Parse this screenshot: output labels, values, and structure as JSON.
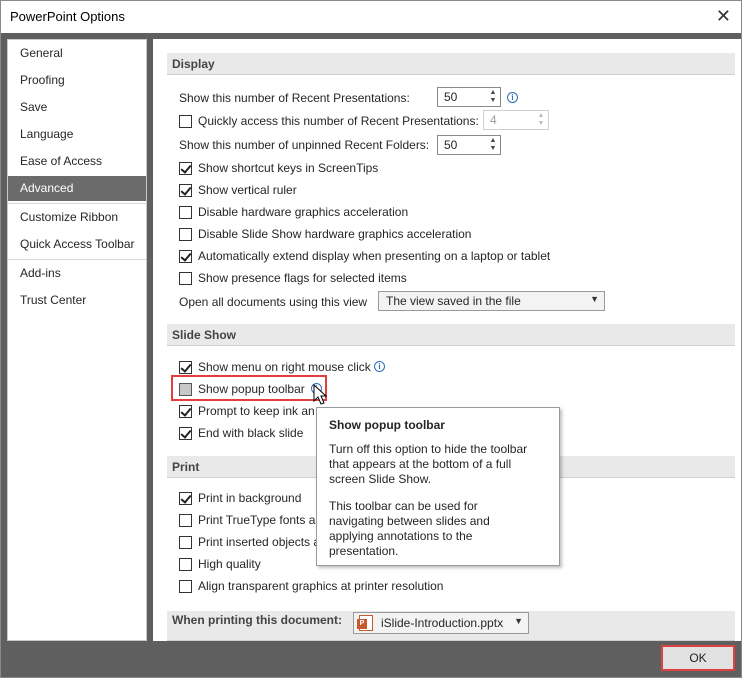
{
  "window": {
    "title": "PowerPoint Options",
    "close_glyph": "✕"
  },
  "nav": {
    "items": [
      "General",
      "Proofing",
      "Save",
      "Language",
      "Ease of Access",
      "Advanced",
      "Customize Ribbon",
      "Quick Access Toolbar",
      "Add-ins",
      "Trust Center"
    ],
    "active": "Advanced"
  },
  "display": {
    "header": "Display",
    "recent_presentations_label": "Show this number of Recent Presentations:",
    "recent_presentations_value": "50",
    "quick_access_label": "Quickly access this number of Recent Presentations:",
    "quick_access_value": "4",
    "quick_access_checked": false,
    "unpinned_folders_label": "Show this number of unpinned Recent Folders:",
    "unpinned_folders_value": "50",
    "options": [
      {
        "label": "Show shortcut keys in ScreenTips",
        "checked": true
      },
      {
        "label": "Show vertical ruler",
        "checked": true
      },
      {
        "label": "Disable hardware graphics acceleration",
        "checked": false
      },
      {
        "label": "Disable Slide Show hardware graphics acceleration",
        "checked": false
      },
      {
        "label": "Automatically extend display when presenting on a laptop or tablet",
        "checked": true
      },
      {
        "label": "Show presence flags for selected items",
        "checked": false
      }
    ],
    "open_docs_label": "Open all documents using this view",
    "open_docs_value": "The view saved in the file"
  },
  "slideshow": {
    "header": "Slide Show",
    "options": [
      {
        "label": "Show menu on right mouse click",
        "checked": true
      },
      {
        "label": "Show popup toolbar",
        "checked": false
      },
      {
        "label": "Prompt to keep ink an",
        "checked": true
      },
      {
        "label": "End with black slide",
        "checked": true
      }
    ]
  },
  "print": {
    "header": "Print",
    "options": [
      {
        "label": "Print in background",
        "checked": true
      },
      {
        "label": "Print TrueType fonts a",
        "checked": false
      },
      {
        "label": "Print inserted objects a",
        "checked": false
      },
      {
        "label": "High quality",
        "checked": false
      },
      {
        "label": "Align transparent graphics at printer resolution",
        "checked": false
      }
    ],
    "when_printing_label": "When printing this document:",
    "document_value": "iSlide-Introduction.pptx",
    "document_icon": "P"
  },
  "tooltip": {
    "title": "Show popup toolbar",
    "para1": "Turn off this option to hide the toolbar that appears at the bottom of a full screen Slide Show.",
    "para2": "This toolbar can be used for navigating between slides and applying annotations to the presentation."
  },
  "footer": {
    "ok_label": "OK"
  },
  "colors": {
    "highlight": "#e04040",
    "active_nav": "#6b6b6b",
    "info_blue": "#2a6ebb"
  }
}
